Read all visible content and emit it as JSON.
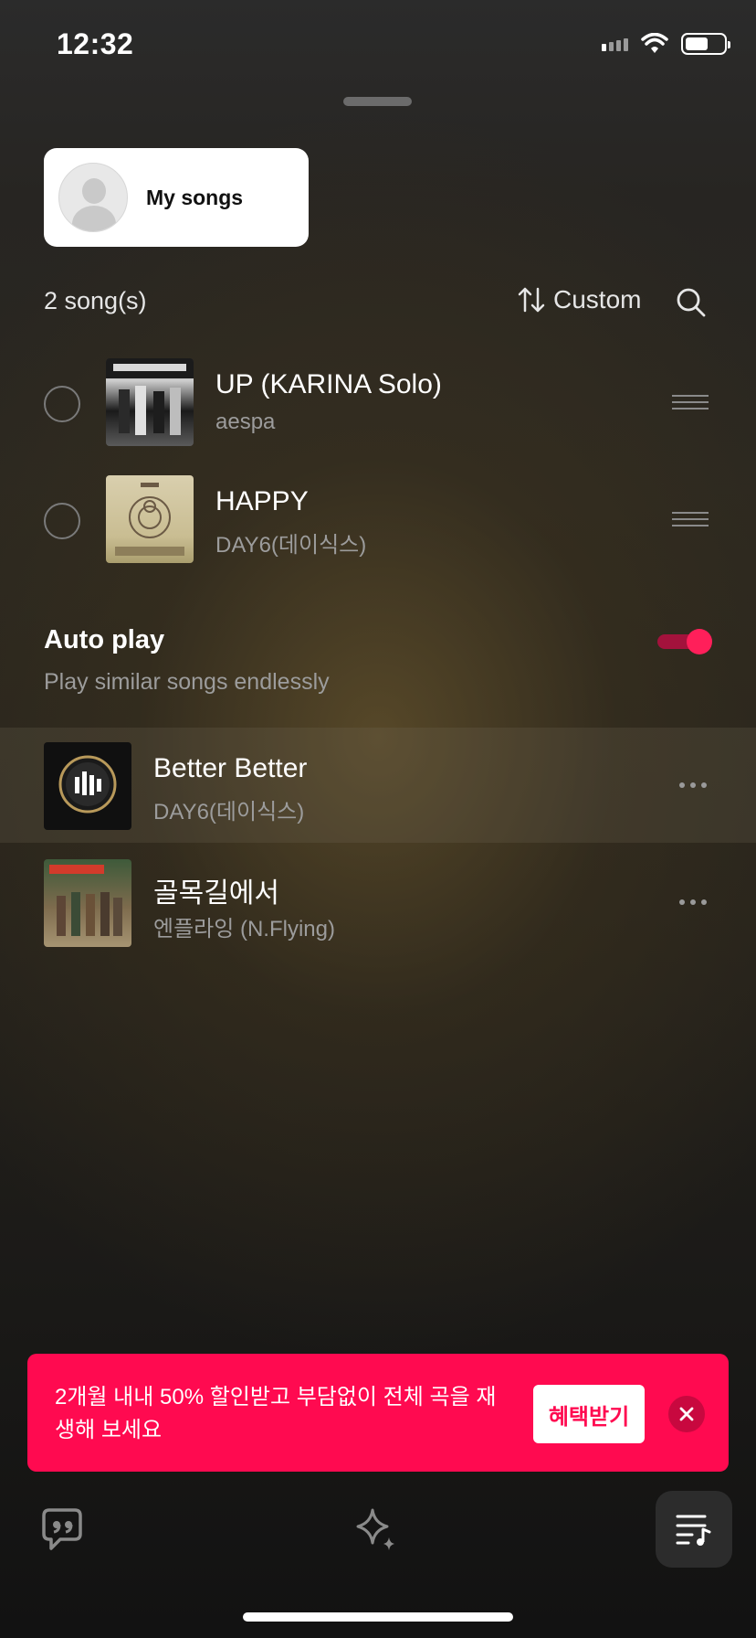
{
  "status_bar": {
    "time": "12:32"
  },
  "header": {
    "my_songs_label": "My songs"
  },
  "list_controls": {
    "count": "2 song(s)",
    "sort_label": "Custom"
  },
  "playlist": [
    {
      "title": "UP (KARINA Solo)",
      "artist": "aespa"
    },
    {
      "title": "HAPPY",
      "artist": "DAY6(데이식스)"
    }
  ],
  "autoplay": {
    "title": "Auto play",
    "subtitle": "Play similar songs endlessly",
    "enabled": true,
    "accent": "#ff1f5a"
  },
  "recommended": [
    {
      "title": "Better Better",
      "artist": "DAY6(데이식스)"
    },
    {
      "title": "골목길에서",
      "artist": "엔플라잉 (N.Flying)"
    }
  ],
  "promo": {
    "text": "2개월 내내 50% 할인받고 부담없이 전체 곡을 재생해 보세요",
    "button": "혜택받기",
    "color": "#ff0a50"
  },
  "tab_bar": {
    "icons": [
      "lyrics-icon",
      "sparkle-icon",
      "playlist-icon"
    ]
  }
}
